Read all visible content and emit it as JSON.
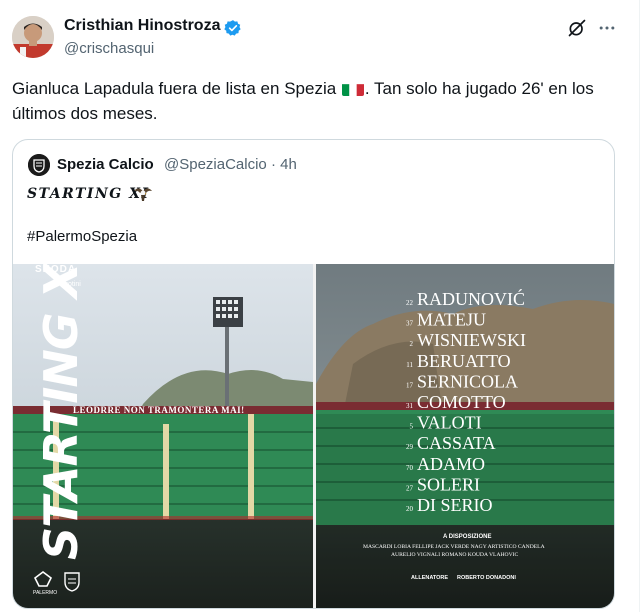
{
  "tweet": {
    "author_name": "Cristhian Hinostroza",
    "author_handle": "@crischasqui",
    "text_before_flag": "Gianluca Lapadula fuera de lista en Spezia ",
    "text_after_flag": ". Tan solo ha jugado 26' en los últimos dos meses.",
    "verified_color": "#1d9bf0"
  },
  "quote": {
    "author_name": "Spezia Calcio",
    "author_handle": "@SpeziaCalcio · 4h",
    "starting_text": "STARTING XI",
    "hashtag": "#PalermoSpezia"
  },
  "lineup": {
    "sponsor": "SKODA",
    "sponsor_sub": "Brotini",
    "vertical_title": "STARTING XI",
    "banner_text": "LEODRRE NON TRAMONTERA MAI!",
    "players": [
      {
        "number": "22",
        "name": "RADUNOVIĆ"
      },
      {
        "number": "37",
        "name": "MATEJU"
      },
      {
        "number": "2",
        "name": "WISNIEWSKI"
      },
      {
        "number": "11",
        "name": "BERUATTO"
      },
      {
        "number": "17",
        "name": "SERNICOLA"
      },
      {
        "number": "31",
        "name": "COMOTTO"
      },
      {
        "number": "5",
        "name": "VALOTI"
      },
      {
        "number": "29",
        "name": "CASSATA"
      },
      {
        "number": "70",
        "name": "ADAMO"
      },
      {
        "number": "27",
        "name": "SOLERI"
      },
      {
        "number": "20",
        "name": "DI SERIO"
      }
    ],
    "bench_title": "A DISPOSIZIONE",
    "bench_line1": "MASCARDI LOBIA FELLIPE JACK VERDE NAGY ARTISTICO CANDELA",
    "bench_line2": "AURELIO VIGNALI ROMANO KOUDA VLAHOVIC",
    "coach_label": "ALLENATORE",
    "coach_name": "ROBERTO DONADONI",
    "club_logo_text": "PALERMO"
  },
  "colors": {
    "sky": "#c9d3dc",
    "stand_green": "#2f8a55",
    "rock": "#8a7a62"
  }
}
